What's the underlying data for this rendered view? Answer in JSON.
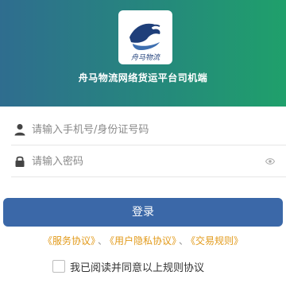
{
  "header": {
    "logo_text": "舟马物流",
    "title": "舟马物流网络货运平台司机端"
  },
  "form": {
    "phone_placeholder": "请输入手机号/身份证号码",
    "password_placeholder": "请输入密码"
  },
  "actions": {
    "login_label": "登录"
  },
  "agreements": {
    "service": "《服务协议》",
    "privacy": "《用户隐私协议》",
    "trade": "《交易规则》",
    "separator": "、"
  },
  "consent": {
    "label": "我已阅读并同意以上规则协议",
    "checked": false
  },
  "icons": {
    "user": "user-icon",
    "lock": "lock-icon",
    "eye": "eye-icon"
  },
  "colors": {
    "header_start": "#2f6d8f",
    "header_end": "#1fa06b",
    "button": "#3b68a8",
    "link": "#e29a1a"
  }
}
